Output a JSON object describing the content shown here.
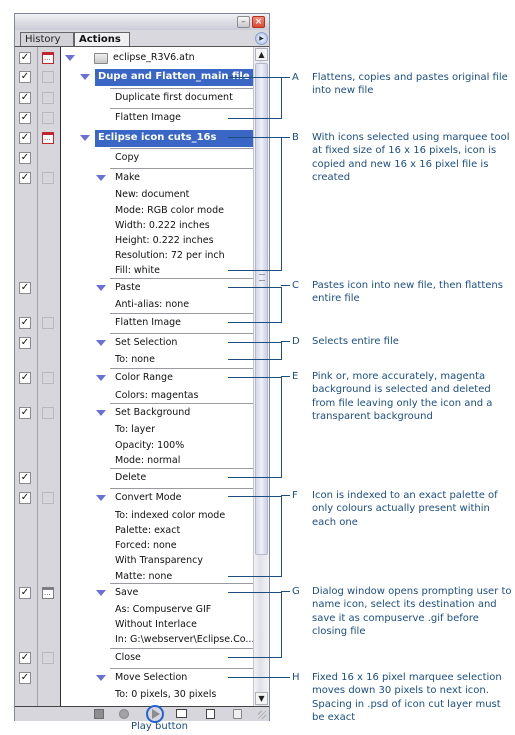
{
  "panel": {
    "tabs": [
      {
        "label": "History",
        "active": false
      },
      {
        "label": "Actions",
        "active": true
      }
    ],
    "window_buttons": {
      "minimize": "minimize-icon",
      "close": "close-icon"
    },
    "set_name": "eclipse_R3V6.atn",
    "rows": [
      {
        "label": "Dupe and Flatten_main file",
        "level": "action",
        "selected": true,
        "expanded": true,
        "checked": true,
        "dialog": "empty"
      },
      {
        "label": "Duplicate first document",
        "level": "step",
        "checked": true,
        "dialog": "empty"
      },
      {
        "label": "Flatten Image",
        "level": "step",
        "checked": true,
        "dialog": "empty"
      },
      {
        "label": "Eclipse icon cuts_16s",
        "level": "action",
        "selected": true,
        "expanded": true,
        "checked": true,
        "dialog": "on"
      },
      {
        "label": "Copy",
        "level": "step",
        "checked": true,
        "dialog": "none"
      },
      {
        "label": "Make",
        "level": "step",
        "expanded": true,
        "checked": true,
        "dialog": "empty"
      },
      {
        "label": "New: document",
        "level": "param"
      },
      {
        "label": "Mode: RGB color mode",
        "level": "param"
      },
      {
        "label": "Width: 0.222 inches",
        "level": "param"
      },
      {
        "label": "Height: 0.222 inches",
        "level": "param"
      },
      {
        "label": "Resolution: 72 per inch",
        "level": "param"
      },
      {
        "label": "Fill: white",
        "level": "param"
      },
      {
        "label": "Paste",
        "level": "step",
        "expanded": true,
        "checked": true,
        "dialog": "none"
      },
      {
        "label": "Anti-alias: none",
        "level": "param"
      },
      {
        "label": "Flatten Image",
        "level": "step",
        "checked": true,
        "dialog": "empty"
      },
      {
        "label": "Set Selection",
        "level": "step",
        "expanded": true,
        "checked": true,
        "dialog": "none"
      },
      {
        "label": "To: none",
        "level": "param"
      },
      {
        "label": "Color Range",
        "level": "step",
        "expanded": true,
        "checked": true,
        "dialog": "empty"
      },
      {
        "label": "Colors: magentas",
        "level": "param"
      },
      {
        "label": "Set Background",
        "level": "step",
        "expanded": true,
        "checked": true,
        "dialog": "empty"
      },
      {
        "label": "To: layer",
        "level": "param"
      },
      {
        "label": "Opacity: 100%",
        "level": "param"
      },
      {
        "label": "Mode: normal",
        "level": "param"
      },
      {
        "label": "Delete",
        "level": "step",
        "checked": true,
        "dialog": "none"
      },
      {
        "label": "Convert Mode",
        "level": "step",
        "expanded": true,
        "checked": true,
        "dialog": "empty"
      },
      {
        "label": "To: indexed color mode",
        "level": "param"
      },
      {
        "label": "Palette: exact",
        "level": "param"
      },
      {
        "label": "Forced: none",
        "level": "param"
      },
      {
        "label": "With Transparency",
        "level": "param"
      },
      {
        "label": "Matte: none",
        "level": "param"
      },
      {
        "label": "Save",
        "level": "step",
        "expanded": true,
        "checked": true,
        "dialog": "gray"
      },
      {
        "label": "As: Compuserve GIF",
        "level": "param"
      },
      {
        "label": "Without Interlace",
        "level": "param"
      },
      {
        "label": "In: G:\\webserver\\Eclipse.Co...",
        "level": "param"
      },
      {
        "label": "Close",
        "level": "step",
        "checked": true,
        "dialog": "empty"
      },
      {
        "label": "Move Selection",
        "level": "step",
        "expanded": true,
        "checked": true,
        "dialog": "none"
      },
      {
        "label": "To: 0 pixels, 30 pixels",
        "level": "param"
      }
    ],
    "toolbar": {
      "stop": "stop-icon",
      "record": "record-icon",
      "play": "play-icon",
      "new_set": "folder-icon",
      "new_action": "new-action-icon",
      "delete": "trash-icon"
    }
  },
  "annotations": [
    {
      "letter": "A",
      "text": "Flattens, copies and pastes original file into new file"
    },
    {
      "letter": "B",
      "text": "With icons selected using marquee tool at fixed size of 16 x 16 pixels, icon is copied and new 16 x 16 pixel file is created"
    },
    {
      "letter": "C",
      "text": "Pastes icon into new file, then flattens entire file"
    },
    {
      "letter": "D",
      "text": "Selects entire file"
    },
    {
      "letter": "E",
      "text": "Pink or, more accurately, magenta background is selected and deleted from file leaving only the icon and a transparent background"
    },
    {
      "letter": "F",
      "text": "Icon is indexed to an exact palette of only colours actually present within each one"
    },
    {
      "letter": "G",
      "text": "Dialog window opens prompting user to name icon, select its destination and save it as compuserve .gif before closing file"
    },
    {
      "letter": "H",
      "text": "Fixed 16 x 16 pixel marquee selection moves down 30 pixels to next icon. Spacing in .psd of icon cut layer must be exact"
    }
  ],
  "caption": "Play button",
  "colors": {
    "selection": "#3a67c5",
    "annotation": "#1b4f82",
    "dialog_on": "#c0262b"
  }
}
